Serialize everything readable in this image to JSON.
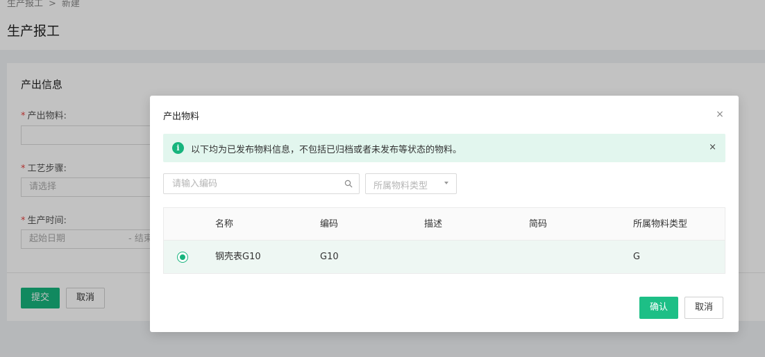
{
  "breadcrumb": {
    "root": "生产报工",
    "separator": ">",
    "current": "新建"
  },
  "page": {
    "title": "生产报工"
  },
  "form": {
    "section_title": "产出信息",
    "fields": [
      {
        "required": "*",
        "label": "产出物料:",
        "placeholder": ""
      },
      {
        "required": "*",
        "label": "工艺步骤:",
        "placeholder": "请选择"
      },
      {
        "required": "*",
        "label": "生产时间:",
        "start_placeholder": "起始日期",
        "range_sep": "- 结束"
      }
    ],
    "submit_label": "提交",
    "cancel_label": "取消"
  },
  "modal": {
    "title": "产出物料",
    "close_glyph": "×",
    "alert": {
      "icon_glyph": "i",
      "text": "以下均为已发布物料信息，不包括已归档或者未发布等状态的物料。",
      "close_glyph": "×"
    },
    "search": {
      "placeholder": "请输入编码",
      "value": ""
    },
    "type_select": {
      "placeholder": "所属物料类型"
    },
    "table": {
      "headers": [
        "名称",
        "编码",
        "描述",
        "简码",
        "所属物料类型"
      ],
      "rows": [
        {
          "selected": true,
          "name": "钢壳表G10",
          "code": "G10",
          "desc": "",
          "short": "",
          "type": "G"
        }
      ]
    },
    "confirm_label": "确认",
    "cancel_label": "取消"
  },
  "colors": {
    "accent": "#17b47d",
    "alert_bg": "#e2f6ee",
    "row_selected_bg": "#eef7f3"
  }
}
